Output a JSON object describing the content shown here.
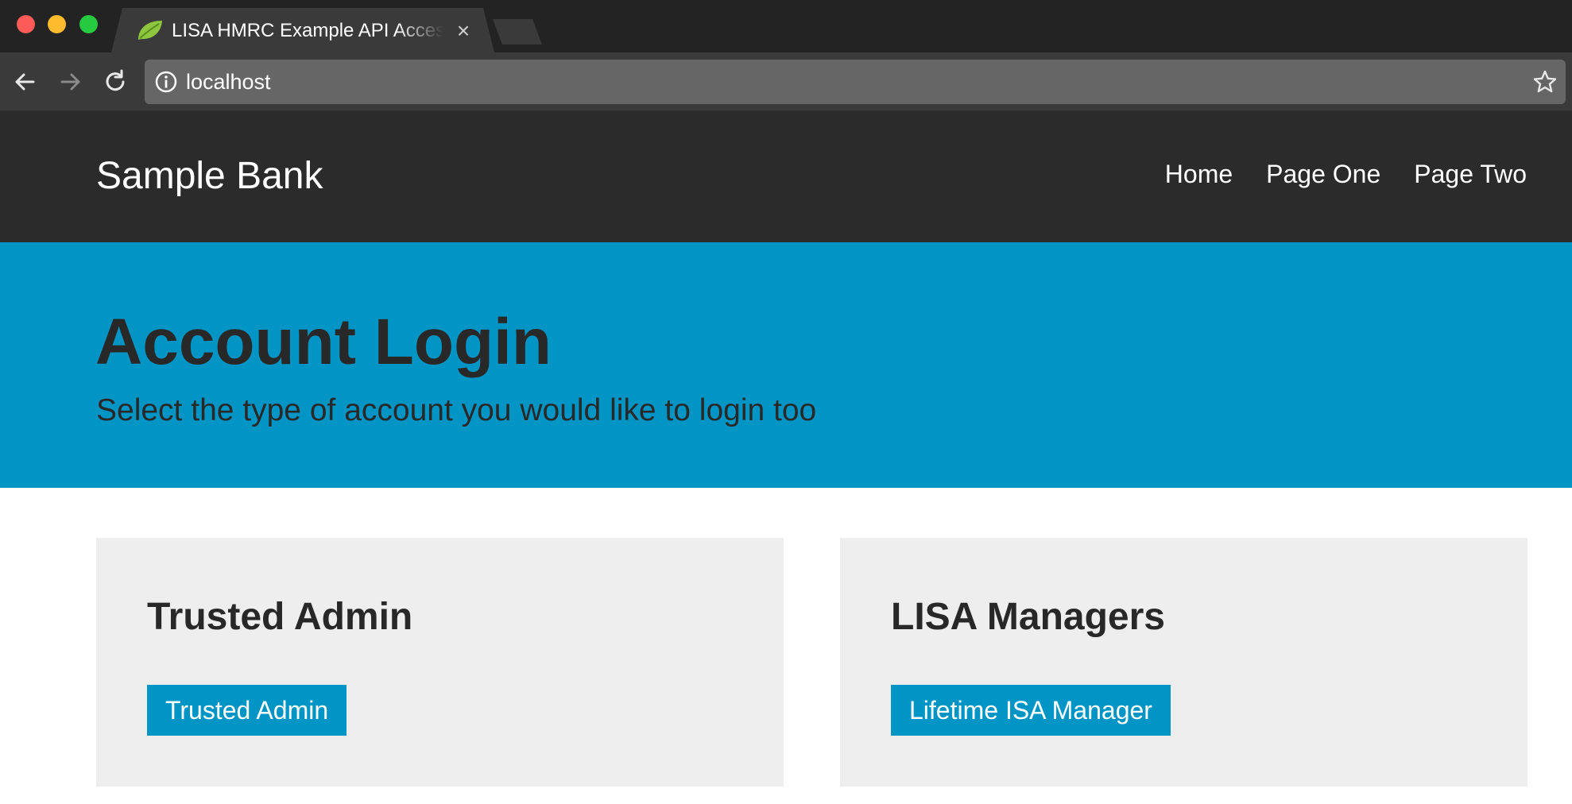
{
  "browser": {
    "tab_title": "LISA HMRC Example API Access",
    "tab_close_glyph": "×",
    "url": "localhost",
    "icons": {
      "favicon": "spring-leaf-icon",
      "back": "arrow-left-icon",
      "forward": "arrow-right-icon",
      "reload": "reload-icon",
      "info": "info-icon",
      "bookmark": "star-icon"
    }
  },
  "site": {
    "brand": "Sample Bank",
    "nav": [
      "Home",
      "Page One",
      "Page Two"
    ]
  },
  "hero": {
    "title": "Account Login",
    "subtitle": "Select the type of account you would like to login too"
  },
  "cards": [
    {
      "heading": "Trusted Admin",
      "button": "Trusted Admin"
    },
    {
      "heading": "LISA Managers",
      "button": "Lifetime ISA Manager"
    }
  ],
  "colors": {
    "header_bg": "#2b2b2b",
    "accent": "#0195c5",
    "card_bg": "#eeeeee",
    "text_dark": "#282828"
  }
}
